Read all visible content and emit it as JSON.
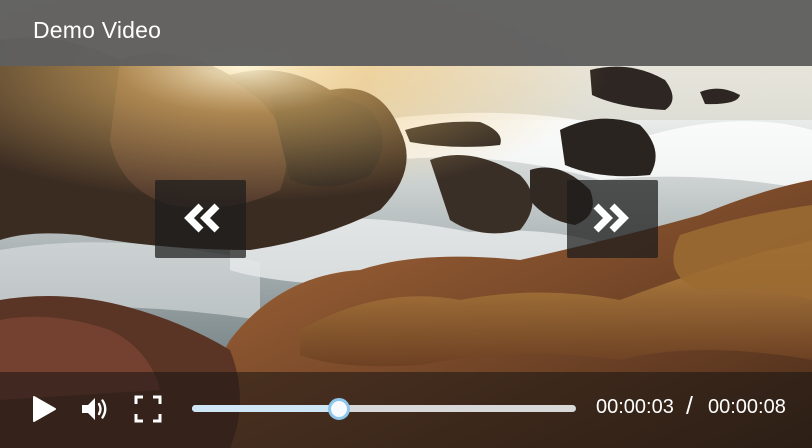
{
  "video": {
    "title": "Demo Video",
    "current_time": "00:00:03",
    "separator": "/",
    "total_time": "00:00:08",
    "progress_fraction": 0.375,
    "is_playing": false
  },
  "icons": {
    "seek_back": "double-chevron-left-icon",
    "seek_forward": "double-chevron-right-icon",
    "play": "play-icon",
    "volume": "volume-icon",
    "fullscreen": "fullscreen-icon"
  },
  "colors": {
    "progress_fill": "#cfe6f6",
    "progress_thumb_border": "#8fc6ec",
    "progress_track": "#d8d8d8",
    "title_bar": "#5f5f5f"
  }
}
